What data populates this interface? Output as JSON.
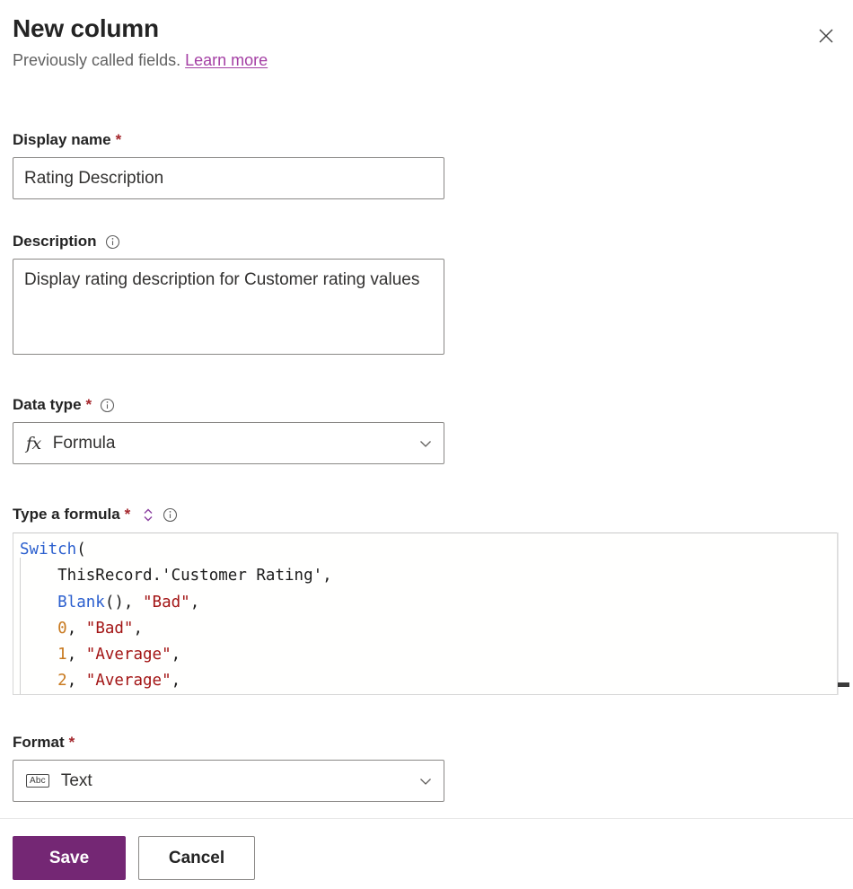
{
  "header": {
    "title": "New column",
    "subtitle_text": "Previously called fields.",
    "learn_more_label": "Learn more",
    "close_icon": "close-icon",
    "link_color": "#A43FA4"
  },
  "fields": {
    "display_name": {
      "label": "Display name",
      "required_marker": "*",
      "value": "Rating Description",
      "placeholder": ""
    },
    "description": {
      "label": "Description",
      "info_icon": "info-icon",
      "value": "Display rating description for Customer rating values",
      "placeholder": ""
    },
    "data_type": {
      "label": "Data type",
      "required_marker": "*",
      "info_icon": "info-icon",
      "selected": "Formula",
      "icon": "fx-icon",
      "icon_text": "fx",
      "chevron_icon": "chevron-down-icon"
    },
    "formula": {
      "label": "Type a formula",
      "required_marker": "*",
      "expand_icon": "expand-collapse-icon",
      "info_icon": "info-icon",
      "lines": [
        [
          {
            "t": "Switch",
            "c": "fn"
          },
          {
            "t": "(",
            "c": "plain"
          }
        ],
        [
          {
            "t": "    ThisRecord.'Customer Rating',",
            "c": "plain"
          }
        ],
        [
          {
            "t": "    ",
            "c": "plain"
          },
          {
            "t": "Blank",
            "c": "fn"
          },
          {
            "t": "(), ",
            "c": "plain"
          },
          {
            "t": "\"Bad\"",
            "c": "str"
          },
          {
            "t": ",",
            "c": "plain"
          }
        ],
        [
          {
            "t": "    ",
            "c": "plain"
          },
          {
            "t": "0",
            "c": "num"
          },
          {
            "t": ", ",
            "c": "plain"
          },
          {
            "t": "\"Bad\"",
            "c": "str"
          },
          {
            "t": ",",
            "c": "plain"
          }
        ],
        [
          {
            "t": "    ",
            "c": "plain"
          },
          {
            "t": "1",
            "c": "num"
          },
          {
            "t": ", ",
            "c": "plain"
          },
          {
            "t": "\"Average\"",
            "c": "str"
          },
          {
            "t": ",",
            "c": "plain"
          }
        ],
        [
          {
            "t": "    ",
            "c": "plain"
          },
          {
            "t": "2",
            "c": "num"
          },
          {
            "t": ", ",
            "c": "plain"
          },
          {
            "t": "\"Average\"",
            "c": "str"
          },
          {
            "t": ",",
            "c": "plain"
          }
        ]
      ],
      "syntax_colors": {
        "function": "#2b5fce",
        "string": "#A31515",
        "number": "#C8791E",
        "plain": "#1c1c1c"
      }
    },
    "format": {
      "label": "Format",
      "required_marker": "*",
      "selected": "Text",
      "icon": "abc-icon",
      "icon_text": "Abc",
      "chevron_icon": "chevron-down-icon"
    }
  },
  "footer": {
    "save_label": "Save",
    "cancel_label": "Cancel",
    "primary_color": "#742774"
  }
}
